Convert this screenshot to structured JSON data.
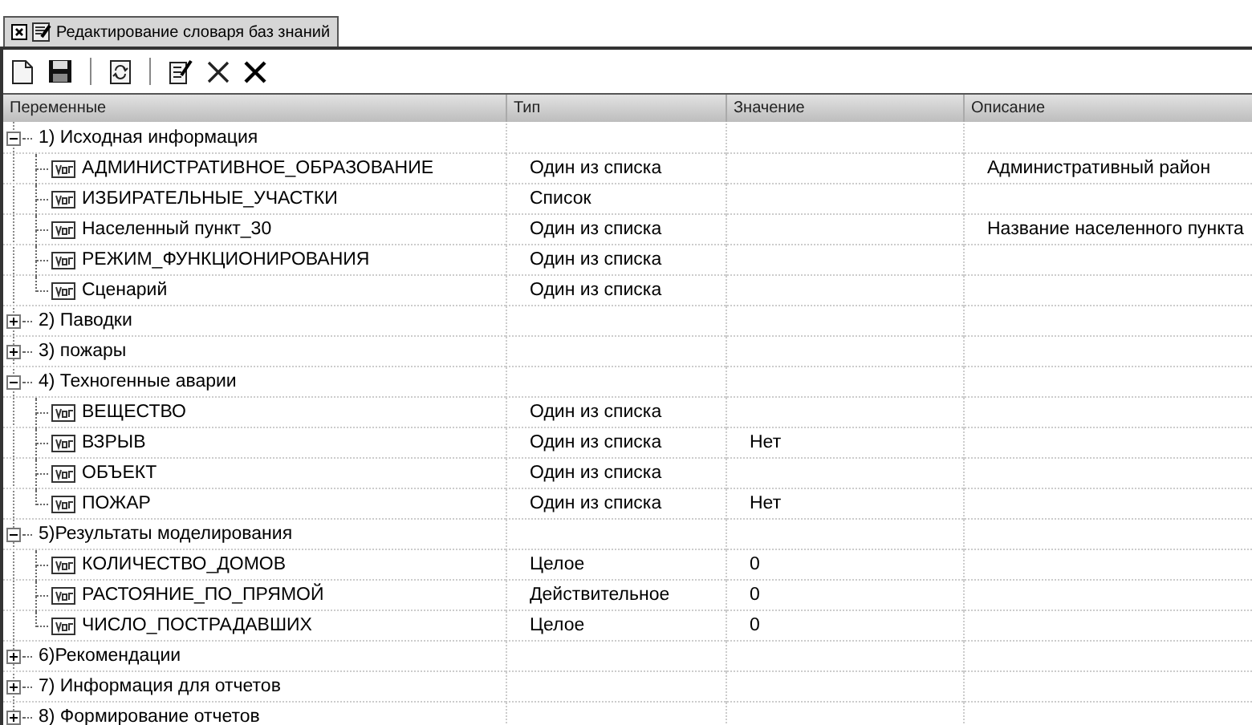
{
  "tab": {
    "title": "Редактирование словаря баз знаний",
    "selected": true
  },
  "columns": [
    "Переменные",
    "Тип",
    "Значение",
    "Описание"
  ],
  "groups": [
    {
      "label": "1) Исходная информация",
      "expanded": true,
      "children": [
        {
          "name": "АДМИНИСТРАТИВНОЕ_ОБРАЗОВАНИЕ",
          "type": "Один из списка",
          "description": "Административный район"
        },
        {
          "name": "ИЗБИРАТЕЛЬНЫЕ_УЧАСТКИ",
          "type": "Список"
        },
        {
          "name": "Населенный пункт_30",
          "type": "Один из списка",
          "description": "Название населенного пункта"
        },
        {
          "name": "РЕЖИМ_ФУНКЦИОНИРОВАНИЯ",
          "type": "Один из списка"
        },
        {
          "name": "Сценарий",
          "type": "Один из списка"
        }
      ]
    },
    {
      "label": "2) Паводки",
      "expanded": false
    },
    {
      "label": "3) пожары",
      "expanded": false
    },
    {
      "label": "4) Техногенные аварии",
      "expanded": true,
      "children": [
        {
          "name": "ВЕЩЕСТВО",
          "type": "Один из списка"
        },
        {
          "name": "ВЗРЫВ",
          "type": "Один из списка",
          "value": "Нет"
        },
        {
          "name": "ОБЪЕКТ",
          "type": "Один из списка"
        },
        {
          "name": "ПОЖАР",
          "type": "Один из списка",
          "value": "Нет"
        }
      ]
    },
    {
      "label": "5)Результаты моделирования",
      "expanded": true,
      "children": [
        {
          "name": "КОЛИЧЕСТВО_ДОМОВ",
          "type": "Целое",
          "value": "0"
        },
        {
          "name": "РАСТОЯНИЕ_ПО_ПРЯМОЙ",
          "type": "Действительное",
          "value": "0"
        },
        {
          "name": "ЧИСЛО_ПОСТРАДАВШИХ",
          "type": "Целое",
          "value": "0"
        }
      ]
    },
    {
      "label": "6)Рекомендации",
      "expanded": false
    },
    {
      "label": "7) Информация для отчетов",
      "expanded": false
    },
    {
      "label": "8) Формирование отчетов",
      "expanded": false
    }
  ]
}
